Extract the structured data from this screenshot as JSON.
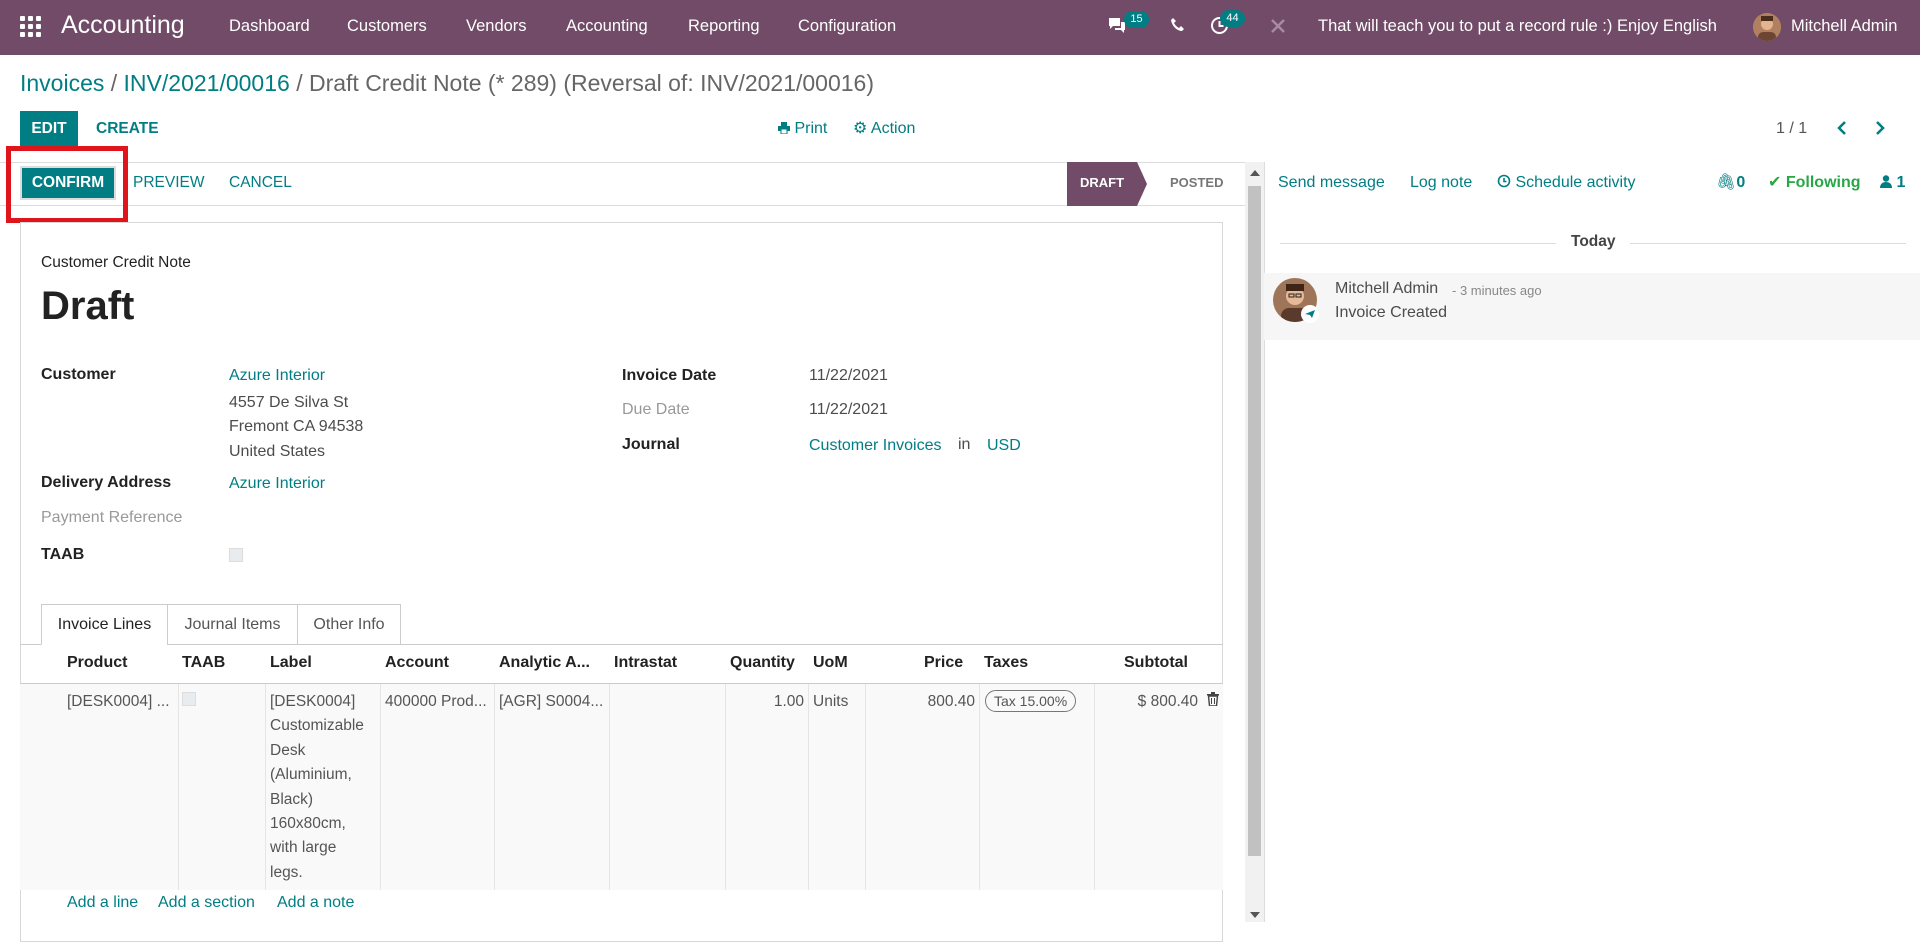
{
  "topbar": {
    "brand": "Accounting",
    "menus": [
      "Dashboard",
      "Customers",
      "Vendors",
      "Accounting",
      "Reporting",
      "Configuration"
    ],
    "messages_count": "15",
    "activities_count": "44",
    "announcement": "That will teach you to put a record rule :) Enjoy English",
    "user": "Mitchell Admin"
  },
  "breadcrumb": {
    "item1": "Invoices",
    "sep": "/",
    "item2": "INV/2021/00016",
    "current": "Draft Credit Note (* 289) (Reversal of: INV/2021/00016)"
  },
  "control": {
    "edit": "EDIT",
    "create": "CREATE",
    "print": "Print",
    "action": "Action",
    "pager": "1 / 1"
  },
  "statusbar": {
    "confirm": "CONFIRM",
    "preview": "PREVIEW",
    "cancel": "CANCEL",
    "stage_draft": "DRAFT",
    "stage_posted": "POSTED"
  },
  "form": {
    "doc_type": "Customer Credit Note",
    "title": "Draft",
    "customer_label": "Customer",
    "customer": "Azure Interior",
    "address": [
      "4557 De Silva St",
      "Fremont CA 94538",
      "United States"
    ],
    "delivery_label": "Delivery Address",
    "delivery": "Azure Interior",
    "payment_ref_label": "Payment Reference",
    "taab_label": "TAAB",
    "invoice_date_label": "Invoice Date",
    "invoice_date": "11/22/2021",
    "due_date_label": "Due Date",
    "due_date": "11/22/2021",
    "journal_label": "Journal",
    "journal": "Customer Invoices",
    "journal_in": "in",
    "currency": "USD"
  },
  "tabs": [
    "Invoice Lines",
    "Journal Items",
    "Other Info"
  ],
  "lines": {
    "columns": [
      "Product",
      "TAAB",
      "Label",
      "Account",
      "Analytic A...",
      "Intrastat",
      "Quantity",
      "UoM",
      "Price",
      "Taxes",
      "Subtotal"
    ],
    "row": {
      "product": "[DESK0004] ...",
      "label": [
        "[DESK0004]",
        "Customizable",
        "Desk",
        "(Aluminium,",
        "Black)",
        "160x80cm,",
        "with large",
        "legs."
      ],
      "account": "400000 Prod...",
      "analytic": "[AGR] S0004...",
      "quantity": "1.00",
      "uom": "Units",
      "price": "800.40",
      "tax": "Tax 15.00%",
      "subtotal": "$ 800.40"
    },
    "add_line": "Add a line",
    "add_section": "Add a section",
    "add_note": "Add a note"
  },
  "chatter": {
    "send_message": "Send message",
    "log_note": "Log note",
    "schedule": "Schedule activity",
    "attachments": "0",
    "following": "Following",
    "followers": "1",
    "today": "Today",
    "author": "Mitchell Admin",
    "time": "- 3 minutes ago",
    "body": "Invoice Created"
  }
}
